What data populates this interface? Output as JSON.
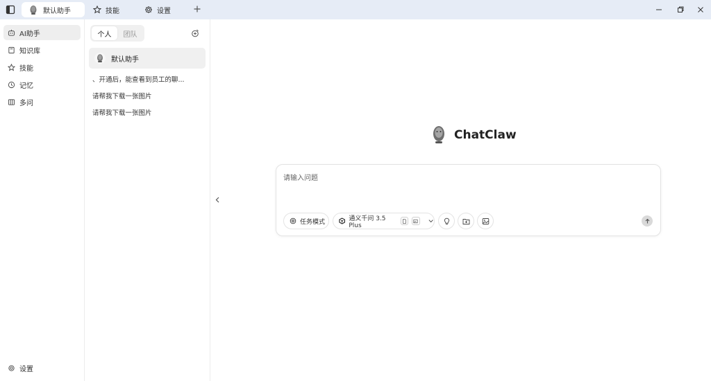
{
  "tabs": [
    {
      "label": "默认助手",
      "icon": "robot-avatar-icon",
      "active": true
    },
    {
      "label": "技能",
      "icon": "star-icon"
    },
    {
      "label": "设置",
      "icon": "gear-icon"
    }
  ],
  "sidebar": {
    "items": [
      {
        "label": "AI助手",
        "icon": "robot-icon",
        "active": true
      },
      {
        "label": "知识库",
        "icon": "book-icon"
      },
      {
        "label": "技能",
        "icon": "star-icon"
      },
      {
        "label": "记忆",
        "icon": "clock-icon"
      },
      {
        "label": "多问",
        "icon": "columns-icon"
      }
    ],
    "footer_label": "设置"
  },
  "conversations": {
    "segments": [
      "个人",
      "团队"
    ],
    "active_segment": "个人",
    "assistant_name": "默认助手",
    "items": [
      "、开通后，能查看到员工的聊...",
      "请帮我下载一张图片",
      "请帮我下载一张图片"
    ]
  },
  "main": {
    "brand_name": "ChatClaw",
    "input_placeholder": "请输入问题",
    "task_mode_label": "任务模式",
    "model_label": "通义千问 3.5 Plus"
  },
  "colors": {
    "titlebar_bg": "#e6ecf6",
    "active_item_bg": "#eeeeee",
    "send_button_bg": "#d9d9d9"
  }
}
